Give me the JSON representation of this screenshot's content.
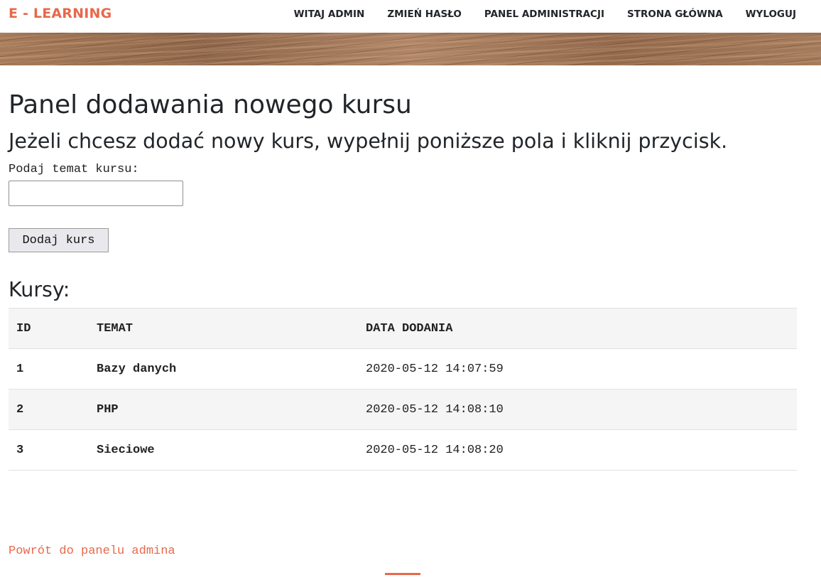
{
  "navbar": {
    "brand": "E - LEARNING",
    "items": [
      {
        "label": "WITAJ ADMIN"
      },
      {
        "label": "ZMIEŃ HASŁO"
      },
      {
        "label": "PANEL ADMINISTRACJI"
      },
      {
        "label": "STRONA GŁÓWNA"
      },
      {
        "label": "WYLOGUJ"
      }
    ]
  },
  "main": {
    "title": "Panel dodawania nowego kursu",
    "subtitle": "Jeżeli chcesz dodać nowy kurs, wypełnij poniższe pola i kliknij przycisk.",
    "form": {
      "label": "Podaj temat kursu:",
      "input_value": "",
      "button_label": "Dodaj kurs"
    },
    "courses_title": "Kursy:",
    "table": {
      "headers": [
        "ID",
        "TEMAT",
        "DATA DODANIA"
      ],
      "rows": [
        [
          "1",
          "Bazy danych",
          "2020-05-12 14:07:59"
        ],
        [
          "2",
          "PHP",
          "2020-05-12 14:08:10"
        ],
        [
          "3",
          "Sieciowe",
          "2020-05-12 14:08:20"
        ]
      ]
    }
  },
  "footer": {
    "back_link": "Powrót do panelu admina"
  },
  "colors": {
    "accent": "#e8684a",
    "stripe": "#f5f5f5"
  }
}
